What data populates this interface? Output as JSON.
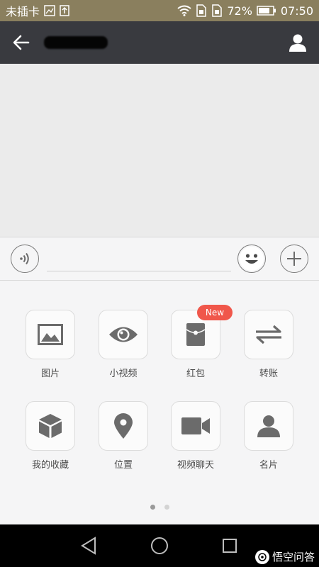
{
  "status_bar": {
    "carrier": "未插卡",
    "battery_percent": "72%",
    "time": "07:50",
    "icons": [
      "image-icon",
      "upload-icon",
      "wifi-icon",
      "sim-icon",
      "sim-icon",
      "battery-icon"
    ]
  },
  "header": {
    "back_icon": "back-arrow-icon",
    "title": "",
    "profile_icon": "person-icon"
  },
  "input_bar": {
    "voice_icon": "voice-icon",
    "text_value": "",
    "emoji_icon": "emoji-icon",
    "plus_icon": "plus-icon"
  },
  "panel": {
    "items": [
      {
        "label": "图片",
        "icon": "photo-icon"
      },
      {
        "label": "小视频",
        "icon": "eye-icon"
      },
      {
        "label": "红包",
        "icon": "red-packet-icon",
        "badge": "New"
      },
      {
        "label": "转账",
        "icon": "transfer-icon"
      },
      {
        "label": "我的收藏",
        "icon": "cube-icon"
      },
      {
        "label": "位置",
        "icon": "location-pin-icon"
      },
      {
        "label": "视频聊天",
        "icon": "video-camera-icon"
      },
      {
        "label": "名片",
        "icon": "contact-card-icon"
      }
    ],
    "page_count": 2,
    "current_page": 1
  },
  "system_nav": {
    "buttons": [
      "back-triangle-icon",
      "home-circle-icon",
      "recents-square-icon"
    ]
  },
  "watermark": {
    "text": "悟空问答"
  },
  "colors": {
    "status_bar": "#8a7f5e",
    "nav_bar": "#393a3f",
    "badge": "#f0574b",
    "icon_gray": "#6b6b6b"
  }
}
